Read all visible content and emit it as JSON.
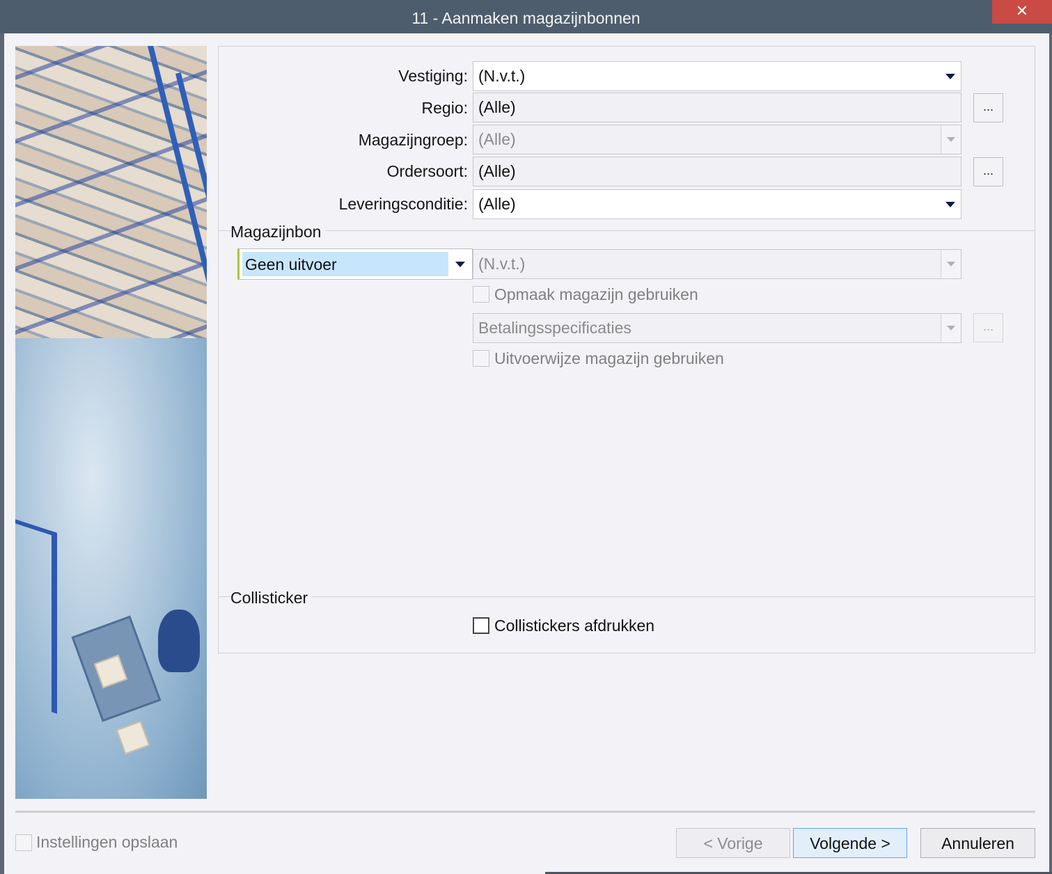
{
  "window": {
    "title": "11 - Aanmaken magazijnbonnen",
    "close_glyph": "✕"
  },
  "filters": {
    "vestiging": {
      "label": "Vestiging:",
      "value": "(N.v.t.)"
    },
    "regio": {
      "label": "Regio:",
      "value": "(Alle)",
      "button": "..."
    },
    "magazijngroep": {
      "label": "Magazijngroep:",
      "value": "(Alle)"
    },
    "ordersoort": {
      "label": "Ordersoort:",
      "value": "(Alle)",
      "button": "..."
    },
    "leveringsconditie": {
      "label": "Leveringsconditie:",
      "value": "(Alle)"
    }
  },
  "magazijnbon": {
    "title": "Magazijnbon",
    "uitvoer": "Geen uitvoer",
    "printer": "(N.v.t.)",
    "opmaak_label": "Opmaak magazijn gebruiken",
    "layout": "Betalingsspecificaties",
    "layout_button": "...",
    "uitvoerwijze_label": "Uitvoerwijze magazijn gebruiken"
  },
  "collisticker": {
    "title": "Collisticker",
    "afdrukken_label": "Collistickers afdrukken"
  },
  "footer": {
    "save_settings_label": "Instellingen opslaan",
    "prev_label": "< Vorige",
    "next_label": "Volgende >",
    "cancel_label": "Annuleren"
  },
  "colors": {
    "titlebar": "#4d5d6d",
    "close": "#c94b44",
    "selection": "#c8e6fb",
    "focus_accent": "#a8c63a"
  }
}
